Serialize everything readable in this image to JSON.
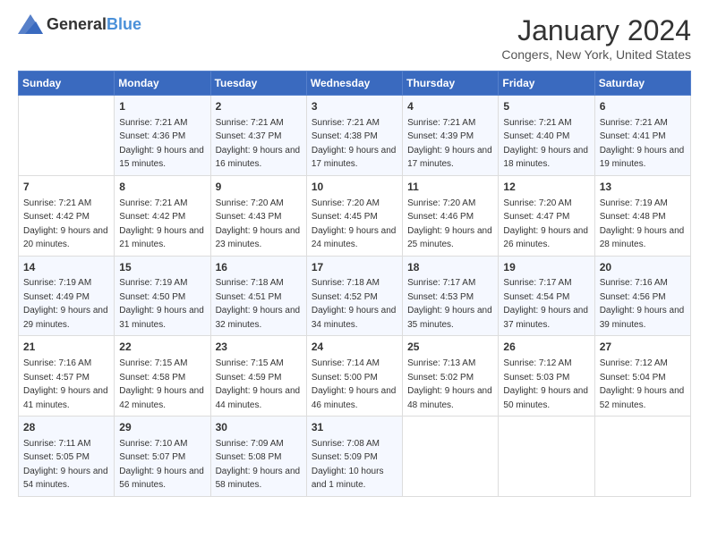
{
  "logo": {
    "text_general": "General",
    "text_blue": "Blue"
  },
  "header": {
    "title": "January 2024",
    "subtitle": "Congers, New York, United States"
  },
  "weekdays": [
    "Sunday",
    "Monday",
    "Tuesday",
    "Wednesday",
    "Thursday",
    "Friday",
    "Saturday"
  ],
  "weeks": [
    [
      {
        "day": "",
        "sunrise": "",
        "sunset": "",
        "daylight": ""
      },
      {
        "day": "1",
        "sunrise": "7:21 AM",
        "sunset": "4:36 PM",
        "daylight": "9 hours and 15 minutes."
      },
      {
        "day": "2",
        "sunrise": "7:21 AM",
        "sunset": "4:37 PM",
        "daylight": "9 hours and 16 minutes."
      },
      {
        "day": "3",
        "sunrise": "7:21 AM",
        "sunset": "4:38 PM",
        "daylight": "9 hours and 17 minutes."
      },
      {
        "day": "4",
        "sunrise": "7:21 AM",
        "sunset": "4:39 PM",
        "daylight": "9 hours and 17 minutes."
      },
      {
        "day": "5",
        "sunrise": "7:21 AM",
        "sunset": "4:40 PM",
        "daylight": "9 hours and 18 minutes."
      },
      {
        "day": "6",
        "sunrise": "7:21 AM",
        "sunset": "4:41 PM",
        "daylight": "9 hours and 19 minutes."
      }
    ],
    [
      {
        "day": "7",
        "sunrise": "7:21 AM",
        "sunset": "4:42 PM",
        "daylight": "9 hours and 20 minutes."
      },
      {
        "day": "8",
        "sunrise": "7:21 AM",
        "sunset": "4:42 PM",
        "daylight": "9 hours and 21 minutes."
      },
      {
        "day": "9",
        "sunrise": "7:20 AM",
        "sunset": "4:43 PM",
        "daylight": "9 hours and 23 minutes."
      },
      {
        "day": "10",
        "sunrise": "7:20 AM",
        "sunset": "4:45 PM",
        "daylight": "9 hours and 24 minutes."
      },
      {
        "day": "11",
        "sunrise": "7:20 AM",
        "sunset": "4:46 PM",
        "daylight": "9 hours and 25 minutes."
      },
      {
        "day": "12",
        "sunrise": "7:20 AM",
        "sunset": "4:47 PM",
        "daylight": "9 hours and 26 minutes."
      },
      {
        "day": "13",
        "sunrise": "7:19 AM",
        "sunset": "4:48 PM",
        "daylight": "9 hours and 28 minutes."
      }
    ],
    [
      {
        "day": "14",
        "sunrise": "7:19 AM",
        "sunset": "4:49 PM",
        "daylight": "9 hours and 29 minutes."
      },
      {
        "day": "15",
        "sunrise": "7:19 AM",
        "sunset": "4:50 PM",
        "daylight": "9 hours and 31 minutes."
      },
      {
        "day": "16",
        "sunrise": "7:18 AM",
        "sunset": "4:51 PM",
        "daylight": "9 hours and 32 minutes."
      },
      {
        "day": "17",
        "sunrise": "7:18 AM",
        "sunset": "4:52 PM",
        "daylight": "9 hours and 34 minutes."
      },
      {
        "day": "18",
        "sunrise": "7:17 AM",
        "sunset": "4:53 PM",
        "daylight": "9 hours and 35 minutes."
      },
      {
        "day": "19",
        "sunrise": "7:17 AM",
        "sunset": "4:54 PM",
        "daylight": "9 hours and 37 minutes."
      },
      {
        "day": "20",
        "sunrise": "7:16 AM",
        "sunset": "4:56 PM",
        "daylight": "9 hours and 39 minutes."
      }
    ],
    [
      {
        "day": "21",
        "sunrise": "7:16 AM",
        "sunset": "4:57 PM",
        "daylight": "9 hours and 41 minutes."
      },
      {
        "day": "22",
        "sunrise": "7:15 AM",
        "sunset": "4:58 PM",
        "daylight": "9 hours and 42 minutes."
      },
      {
        "day": "23",
        "sunrise": "7:15 AM",
        "sunset": "4:59 PM",
        "daylight": "9 hours and 44 minutes."
      },
      {
        "day": "24",
        "sunrise": "7:14 AM",
        "sunset": "5:00 PM",
        "daylight": "9 hours and 46 minutes."
      },
      {
        "day": "25",
        "sunrise": "7:13 AM",
        "sunset": "5:02 PM",
        "daylight": "9 hours and 48 minutes."
      },
      {
        "day": "26",
        "sunrise": "7:12 AM",
        "sunset": "5:03 PM",
        "daylight": "9 hours and 50 minutes."
      },
      {
        "day": "27",
        "sunrise": "7:12 AM",
        "sunset": "5:04 PM",
        "daylight": "9 hours and 52 minutes."
      }
    ],
    [
      {
        "day": "28",
        "sunrise": "7:11 AM",
        "sunset": "5:05 PM",
        "daylight": "9 hours and 54 minutes."
      },
      {
        "day": "29",
        "sunrise": "7:10 AM",
        "sunset": "5:07 PM",
        "daylight": "9 hours and 56 minutes."
      },
      {
        "day": "30",
        "sunrise": "7:09 AM",
        "sunset": "5:08 PM",
        "daylight": "9 hours and 58 minutes."
      },
      {
        "day": "31",
        "sunrise": "7:08 AM",
        "sunset": "5:09 PM",
        "daylight": "10 hours and 1 minute."
      },
      {
        "day": "",
        "sunrise": "",
        "sunset": "",
        "daylight": ""
      },
      {
        "day": "",
        "sunrise": "",
        "sunset": "",
        "daylight": ""
      },
      {
        "day": "",
        "sunrise": "",
        "sunset": "",
        "daylight": ""
      }
    ]
  ]
}
